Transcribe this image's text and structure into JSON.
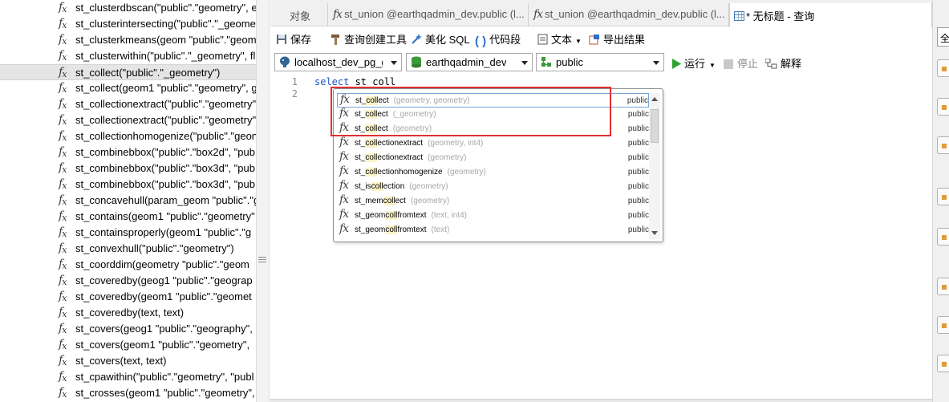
{
  "function_tree": {
    "items": [
      {
        "label": "st_clusterdbscan(\"public\".\"geometry\", e"
      },
      {
        "label": "st_clusterintersecting(\"public\".\"_geome"
      },
      {
        "label": "st_clusterkmeans(geom \"public\".\"geom"
      },
      {
        "label": "st_clusterwithin(\"public\".\"_geometry\", fl"
      },
      {
        "label": "st_collect(\"public\".\"_geometry\")",
        "selected": true
      },
      {
        "label": "st_collect(geom1 \"public\".\"geometry\", g"
      },
      {
        "label": "st_collectionextract(\"public\".\"geometry\""
      },
      {
        "label": "st_collectionextract(\"public\".\"geometry\""
      },
      {
        "label": "st_collectionhomogenize(\"public\".\"geon"
      },
      {
        "label": "st_combinebbox(\"public\".\"box2d\", \"pub"
      },
      {
        "label": "st_combinebbox(\"public\".\"box3d\", \"pub"
      },
      {
        "label": "st_combinebbox(\"public\".\"box3d\", \"pub"
      },
      {
        "label": "st_concavehull(param_geom \"public\".\"g"
      },
      {
        "label": "st_contains(geom1 \"public\".\"geometry\""
      },
      {
        "label": "st_containsproperly(geom1 \"public\".\"g"
      },
      {
        "label": "st_convexhull(\"public\".\"geometry\")"
      },
      {
        "label": "st_coorddim(geometry \"public\".\"geom"
      },
      {
        "label": "st_coveredby(geog1 \"public\".\"geograp"
      },
      {
        "label": "st_coveredby(geom1 \"public\".\"geomet"
      },
      {
        "label": "st_coveredby(text, text)"
      },
      {
        "label": "st_covers(geog1 \"public\".\"geography\","
      },
      {
        "label": "st_covers(geom1 \"public\".\"geometry\", "
      },
      {
        "label": "st_covers(text, text)"
      },
      {
        "label": "st_cpawithin(\"public\".\"geometry\", \"publ"
      },
      {
        "label": "st_crosses(geom1 \"public\".\"geometry\","
      }
    ]
  },
  "tabs": [
    {
      "label": "对象"
    },
    {
      "label": "st_union @earthqadmin_dev.public (l..."
    },
    {
      "label": "st_union @earthqadmin_dev.public (l..."
    },
    {
      "label": "* 无标题 - 查询",
      "active": true
    }
  ],
  "toolbar": {
    "save": "保存",
    "query_builder": "查询创建工具",
    "beautify_sql": "美化 SQL",
    "code_snippet": "代码段",
    "text": "文本",
    "export": "导出结果"
  },
  "connection": {
    "server": "localhost_dev_pg_gl",
    "database": "earthqadmin_dev",
    "schema": "public",
    "run": "运行",
    "stop": "停止",
    "explain": "解释"
  },
  "editor": {
    "line_numbers": [
      "1",
      "2"
    ],
    "keyword": "select",
    "rest": " st_coll"
  },
  "autocomplete": {
    "items": [
      {
        "pre": "st_",
        "hl": "coll",
        "post": "ect",
        "sig": "(geometry, geometry)",
        "schema": "public"
      },
      {
        "pre": "st_",
        "hl": "coll",
        "post": "ect",
        "sig": "(_geometry)",
        "schema": "public"
      },
      {
        "pre": "st_",
        "hl": "coll",
        "post": "ect",
        "sig": "(geometry)",
        "schema": "public"
      },
      {
        "pre": "st_",
        "hl": "coll",
        "post": "ectionextract",
        "sig": "(geometry, int4)",
        "schema": "public"
      },
      {
        "pre": "st_",
        "hl": "coll",
        "post": "ectionextract",
        "sig": "(geometry)",
        "schema": "public"
      },
      {
        "pre": "st_",
        "hl": "coll",
        "post": "ectionhomogenize",
        "sig": "(geometry)",
        "schema": "public"
      },
      {
        "pre": "st_is",
        "hl": "coll",
        "post": "ection",
        "sig": "(geometry)",
        "schema": "public"
      },
      {
        "pre": "st_mem",
        "hl": "coll",
        "post": "ect",
        "sig": "(geometry)",
        "schema": "public"
      },
      {
        "pre": "st_geom",
        "hl": "coll",
        "post": "fromtext",
        "sig": "(text, int4)",
        "schema": "public"
      },
      {
        "pre": "st_geom",
        "hl": "coll",
        "post": "fromtext",
        "sig": "(text)",
        "schema": "public"
      }
    ]
  },
  "right_panel": {
    "first_label": "全"
  },
  "colors": {
    "keyword": "#1a56c7",
    "highlight_box": "#e03030",
    "match_highlight": "#fbf3c8",
    "run_green": "#2fa52f"
  }
}
